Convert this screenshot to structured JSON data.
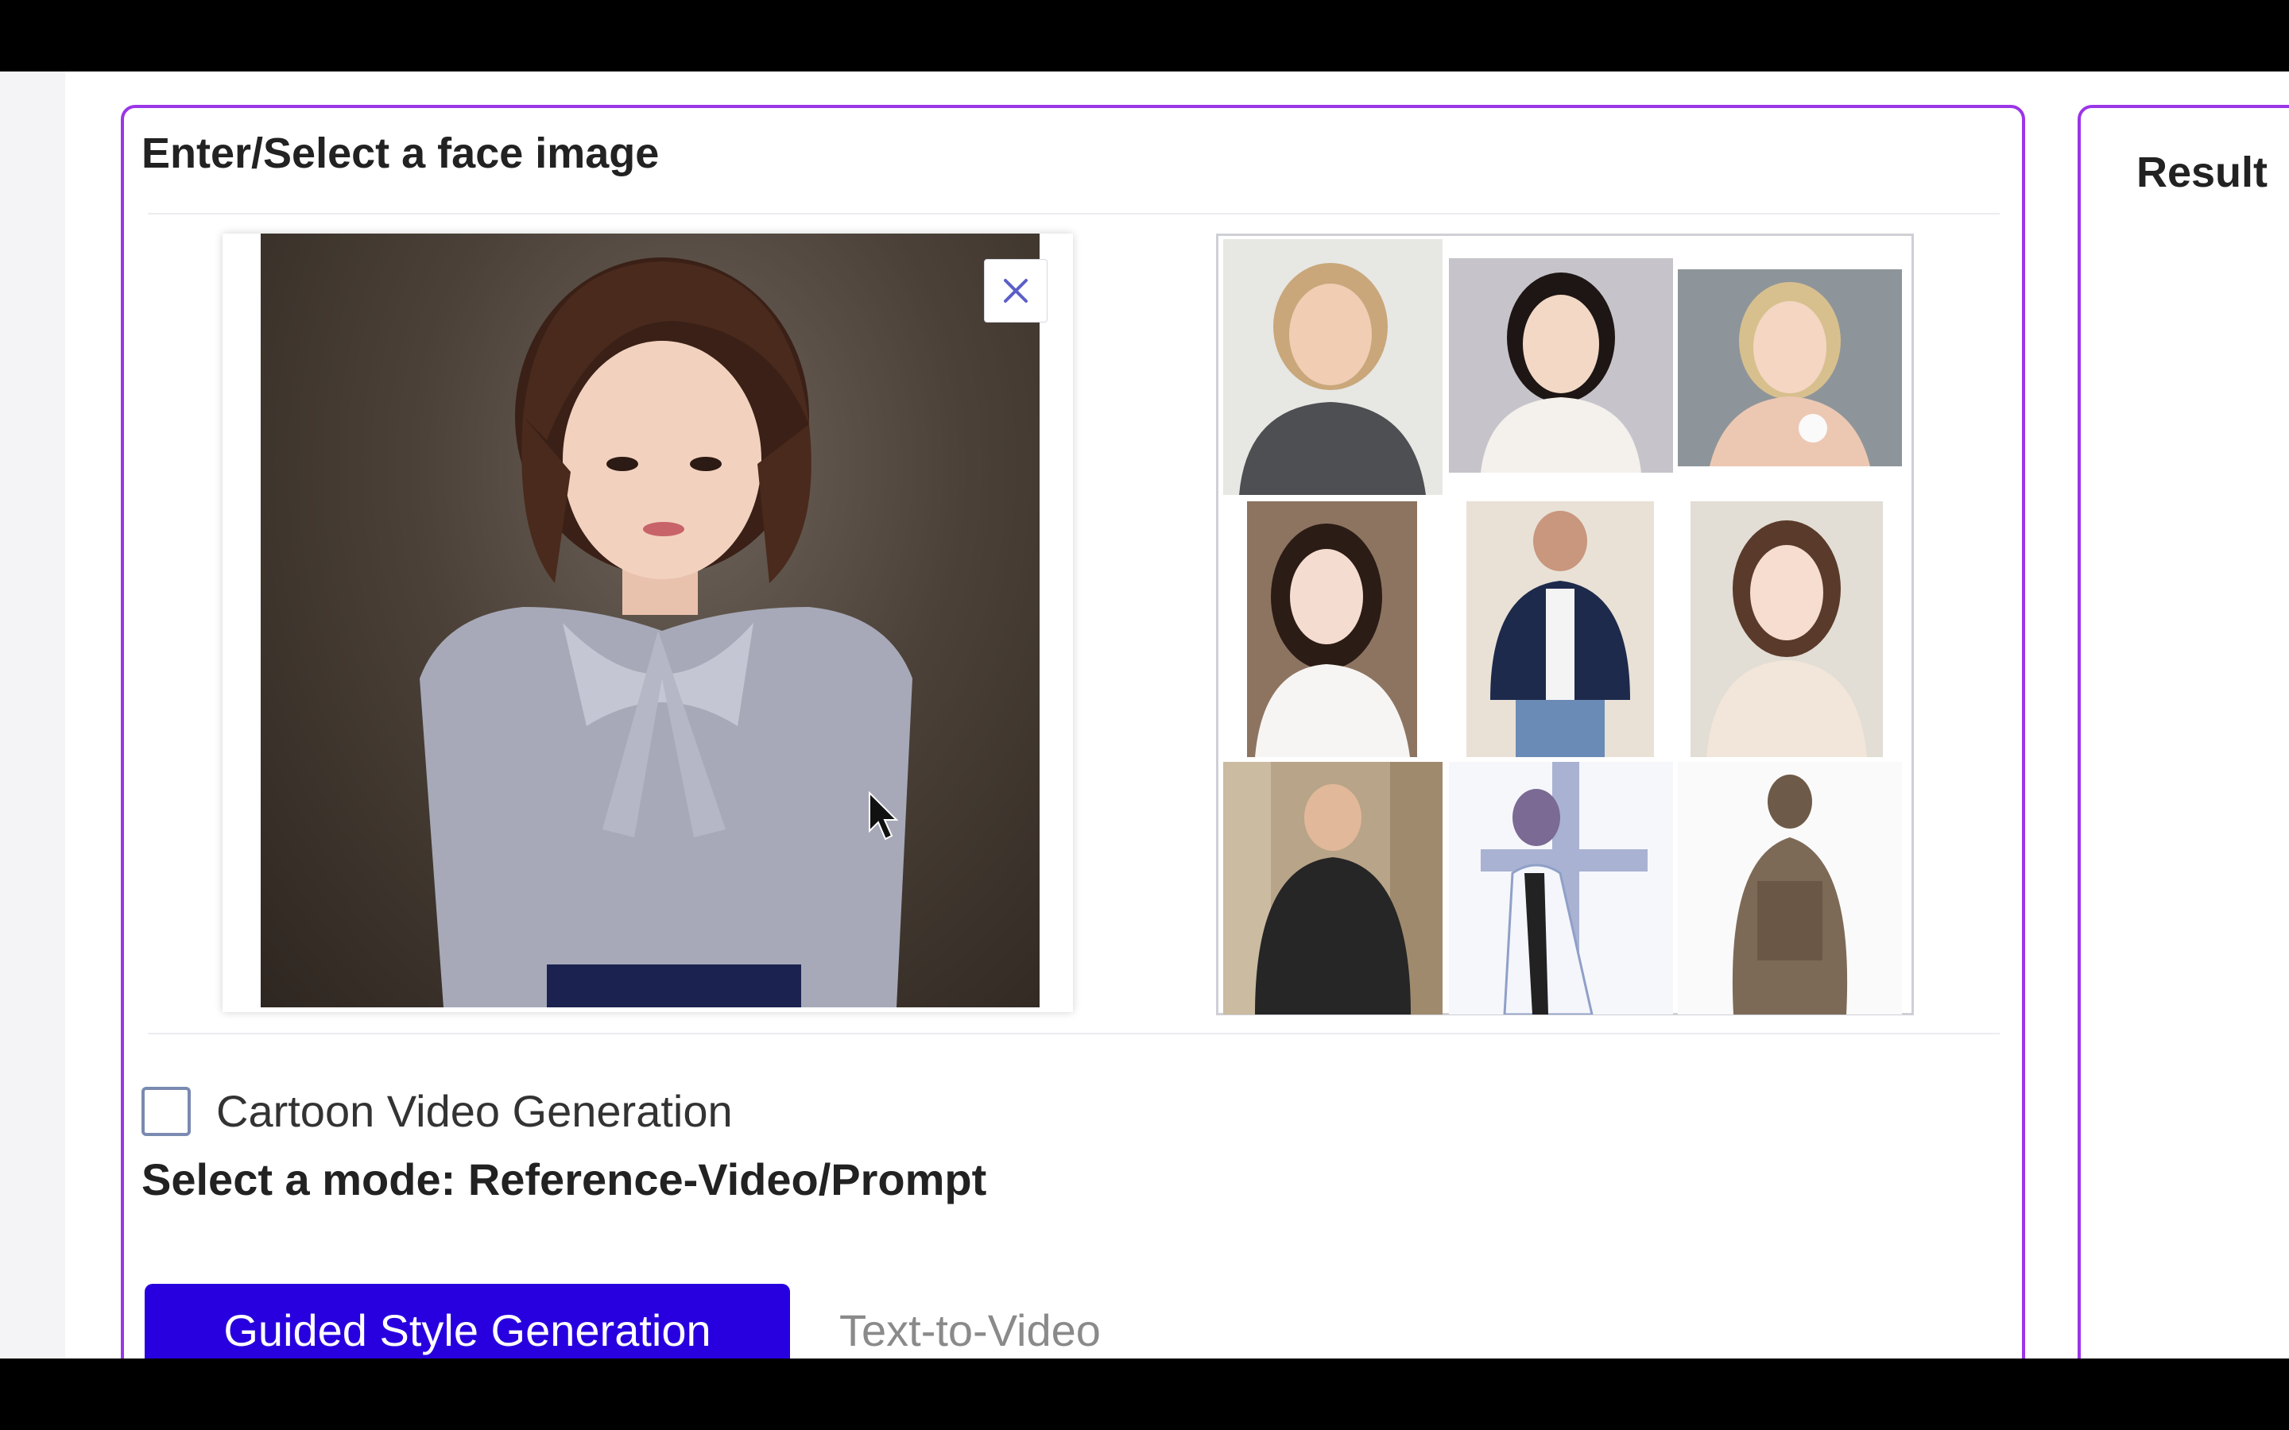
{
  "panel": {
    "title": "Enter/Select a face image",
    "cartoon_checkbox": {
      "label": "Cartoon Video Generation",
      "checked": false
    },
    "mode_label": "Select a mode: Reference-Video/Prompt",
    "tabs": [
      {
        "label": "Guided Style Generation",
        "active": true
      },
      {
        "label": "Text-to-Video",
        "active": false
      }
    ]
  },
  "result": {
    "title": "Result"
  },
  "icons": {
    "close": "close-icon",
    "cursor": "mouse-pointer-icon",
    "pause": "pause-icon"
  },
  "colors": {
    "panel_border": "#9b35e8",
    "tab_active_bg": "#2800e0",
    "tab_inactive_text": "#8a8a8a",
    "close_icon": "#5b5fc7"
  }
}
